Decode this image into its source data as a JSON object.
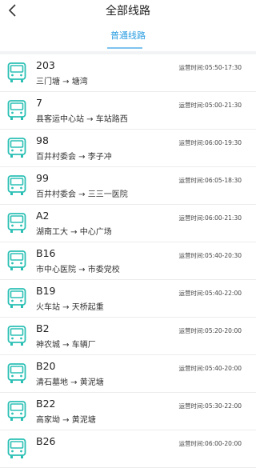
{
  "header": {
    "title": "全部线路",
    "back_icon": "chevron-left-icon"
  },
  "tabs": [
    {
      "label": "普通线路",
      "active": true
    }
  ],
  "colors": {
    "accent": "#2a9de0",
    "bus_icon": "#2cc0b5"
  },
  "routes": [
    {
      "line": "203",
      "from": "三门塘",
      "to": "塘湾",
      "hours": "运营时间:05:50-17:30"
    },
    {
      "line": "7",
      "from": "县客运中心站",
      "to": "车站路西",
      "hours": "运营时间:05:00-21:30"
    },
    {
      "line": "98",
      "from": "百井村委会",
      "to": "李子冲",
      "hours": "运营时间:06:00-19:30"
    },
    {
      "line": "99",
      "from": "百井村委会",
      "to": "三三一医院",
      "hours": "运营时间:06:05-18:30"
    },
    {
      "line": "A2",
      "from": "湖南工大",
      "to": "中心广场",
      "hours": "运营时间:06:00-21:30"
    },
    {
      "line": "B16",
      "from": "市中心医院",
      "to": "市委党校",
      "hours": "运营时间:05:40-20:30"
    },
    {
      "line": "B19",
      "from": "火车站",
      "to": "天桥起重",
      "hours": "运营时间:05:40-22:00"
    },
    {
      "line": "B2",
      "from": "神农城",
      "to": "车辆厂",
      "hours": "运营时间:05:20-20:00"
    },
    {
      "line": "B20",
      "from": "清石墓地",
      "to": "黄泥塘",
      "hours": "运营时间:05:40-20:00"
    },
    {
      "line": "B22",
      "from": "高家坳",
      "to": "黄泥塘",
      "hours": "运营时间:05:30-22:00"
    },
    {
      "line": "B26",
      "from": "",
      "to": "",
      "hours": "运营时间:06:00-20:00"
    }
  ]
}
